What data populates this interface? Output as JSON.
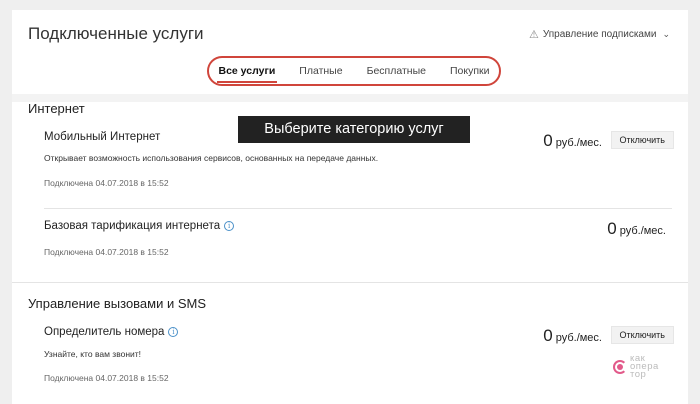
{
  "header": {
    "title": "Подключенные услуги",
    "manage_label": "Управление подписками"
  },
  "tabs": [
    {
      "label": "Все услуги",
      "active": true
    },
    {
      "label": "Платные",
      "active": false
    },
    {
      "label": "Бесплатные",
      "active": false
    },
    {
      "label": "Покупки",
      "active": false
    }
  ],
  "tooltip": "Выберите категорию услуг",
  "sections": [
    {
      "title": "Интернет",
      "services": [
        {
          "name": "Мобильный Интернет",
          "description": "Открывает возможность использования сервисов, основанных на передаче данных.",
          "connected": "Подключена 04.07.2018 в 15:52",
          "price": "0",
          "unit": "руб./мес.",
          "button": "Отключить"
        },
        {
          "name": "Базовая тарификация интернета",
          "description": "",
          "connected": "Подключена 04.07.2018 в 15:52",
          "price": "0",
          "unit": "руб./мес.",
          "button": ""
        }
      ]
    },
    {
      "title": "Управление вызовами и SMS",
      "services": [
        {
          "name": "Определитель номера",
          "description": "Узнайте, кто вам звонит!",
          "connected": "Подключена 04.07.2018 в 15:52",
          "price": "0",
          "unit": "руб./мес.",
          "button": "Отключить"
        }
      ]
    }
  ],
  "watermark": {
    "line1": "как",
    "line2": "опера",
    "line3": "тор",
    "accent": "#e25a8a"
  },
  "colors": {
    "accent": "#d0453b",
    "info": "#4a90c8"
  }
}
